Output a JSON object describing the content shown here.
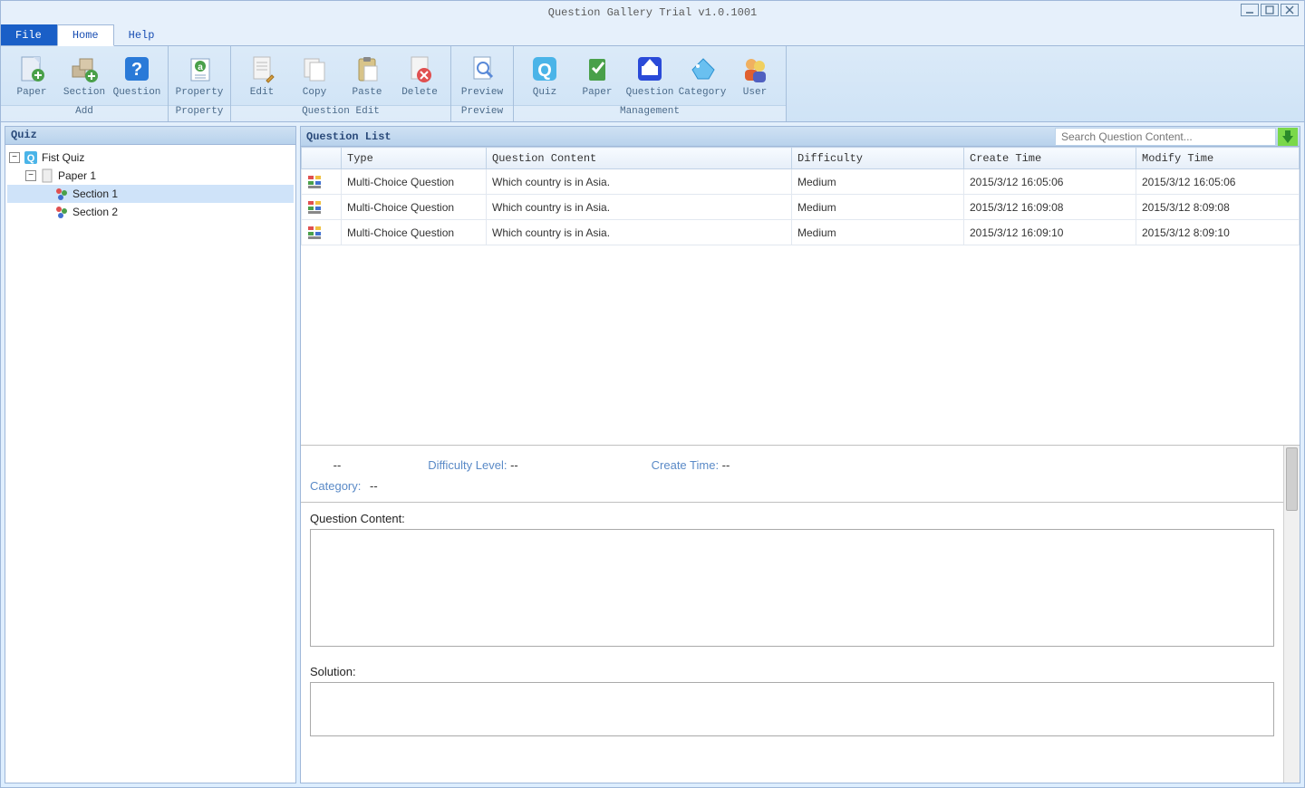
{
  "window": {
    "title": "Question Gallery Trial  v1.0.1001"
  },
  "menu": {
    "file": "File",
    "home": "Home",
    "help": "Help"
  },
  "ribbon": {
    "groups": {
      "add": {
        "label": "Add",
        "buttons": {
          "paper": "Paper",
          "section": "Section",
          "question": "Question"
        }
      },
      "property": {
        "label": "Property",
        "buttons": {
          "property": "Property"
        }
      },
      "qedit": {
        "label": "Question Edit",
        "buttons": {
          "edit": "Edit",
          "copy": "Copy",
          "paste": "Paste",
          "delete": "Delete"
        }
      },
      "preview": {
        "label": "Preview",
        "buttons": {
          "preview": "Preview"
        }
      },
      "management": {
        "label": "Management",
        "buttons": {
          "quiz": "Quiz",
          "paper": "Paper",
          "question": "Question",
          "category": "Category",
          "user": "User"
        }
      }
    }
  },
  "leftpanel": {
    "title": "Quiz"
  },
  "tree": {
    "quiz": "Fist Quiz",
    "paper": "Paper 1",
    "sections": [
      "Section 1",
      "Section 2"
    ]
  },
  "qlist": {
    "title": "Question List",
    "search_placeholder": "Search Question Content...",
    "columns": {
      "type": "Type",
      "content": "Question Content",
      "difficulty": "Difficulty",
      "create": "Create Time",
      "modify": "Modify Time"
    },
    "rows": [
      {
        "type": "Multi-Choice Question",
        "content": "Which country is in Asia.",
        "difficulty": "Medium",
        "create": "2015/3/12 16:05:06",
        "modify": "2015/3/12 16:05:06"
      },
      {
        "type": "Multi-Choice Question",
        "content": "Which country is in Asia.",
        "difficulty": "Medium",
        "create": "2015/3/12 16:09:08",
        "modify": "2015/3/12 8:09:08"
      },
      {
        "type": "Multi-Choice Question",
        "content": "Which country is in Asia.",
        "difficulty": "Medium",
        "create": "2015/3/12 16:09:10",
        "modify": "2015/3/12 8:09:10"
      }
    ]
  },
  "detail": {
    "type_value": "--",
    "difficulty_label": "Difficulty Level: ",
    "difficulty_value": "--",
    "create_label": "Create Time: ",
    "create_value": "--",
    "category_label": "Category:",
    "category_value": "--",
    "qcontent_label": "Question Content:",
    "solution_label": "Solution:"
  }
}
